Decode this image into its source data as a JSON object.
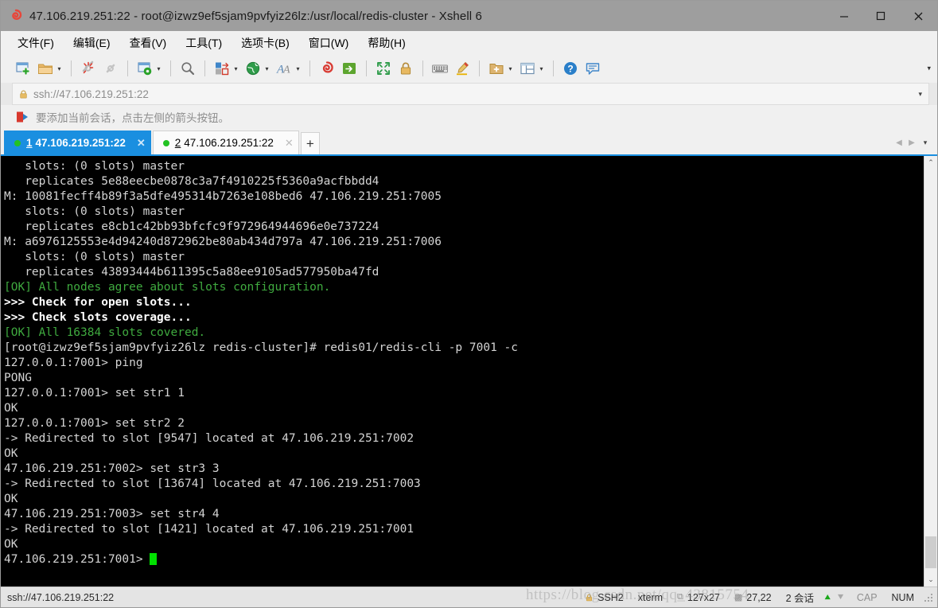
{
  "window": {
    "title": "47.106.219.251:22 - root@izwz9ef5sjam9pvfyiz26lz:/usr/local/redis-cluster - Xshell 6",
    "app_icon": "xshell-icon",
    "minimize": "–",
    "maximize": "☐",
    "close": "✕"
  },
  "menubar": {
    "items": [
      {
        "text": "文件(F)",
        "name": "menu-file"
      },
      {
        "text": "编辑(E)",
        "name": "menu-edit"
      },
      {
        "text": "查看(V)",
        "name": "menu-view"
      },
      {
        "text": "工具(T)",
        "name": "menu-tools"
      },
      {
        "text": "选项卡(B)",
        "name": "menu-tabs"
      },
      {
        "text": "窗口(W)",
        "name": "menu-window"
      },
      {
        "text": "帮助(H)",
        "name": "menu-help"
      }
    ]
  },
  "toolbar": {
    "overflow_caret": "▾",
    "items": [
      {
        "icon": "new-session-icon",
        "caret": false
      },
      {
        "icon": "open-folder-icon",
        "caret": true
      },
      {
        "sep": true
      },
      {
        "icon": "disconnect-icon",
        "caret": false
      },
      {
        "icon": "reconnect-icon",
        "caret": false
      },
      {
        "sep": true
      },
      {
        "icon": "session-properties-icon",
        "caret": true
      },
      {
        "sep": true
      },
      {
        "icon": "find-icon",
        "caret": false
      },
      {
        "sep": true
      },
      {
        "icon": "transfer-icon",
        "caret": true
      },
      {
        "icon": "globe-icon",
        "caret": true
      },
      {
        "icon": "font-icon",
        "caret": true
      },
      {
        "sep": true
      },
      {
        "icon": "xshell-log-icon",
        "caret": false
      },
      {
        "icon": "xftp-icon",
        "caret": false
      },
      {
        "sep": true
      },
      {
        "icon": "fullscreen-icon",
        "caret": false
      },
      {
        "icon": "lock-icon",
        "caret": false
      },
      {
        "sep": true
      },
      {
        "icon": "keyboard-icon",
        "caret": false
      },
      {
        "icon": "highlight-icon",
        "caret": false
      },
      {
        "sep": true
      },
      {
        "icon": "new-folder-icon",
        "caret": true
      },
      {
        "icon": "split-view-icon",
        "caret": true
      },
      {
        "sep": true
      },
      {
        "icon": "help-icon",
        "caret": false
      },
      {
        "icon": "chat-icon",
        "caret": false
      }
    ]
  },
  "address_bar": {
    "lock_icon": "lock-icon",
    "value": "ssh://47.106.219.251:22",
    "placeholder": "ssh://47.106.219.251:22",
    "caret": "▾"
  },
  "hint_bar": {
    "icon": "arrow-flag-icon",
    "text": "要添加当前会话，点击左侧的箭头按钮。"
  },
  "tabs": {
    "items": [
      {
        "number": "1",
        "label": "47.106.219.251:22",
        "active": true,
        "close": "✕",
        "dot_color": "#23c223"
      },
      {
        "number": "2",
        "label": "47.106.219.251:22",
        "active": false,
        "close": "✕",
        "dot_color": "#23c223"
      }
    ],
    "add_label": "+",
    "nav_prev": "◀",
    "nav_next": "▶",
    "nav_caret": "▾"
  },
  "terminal": {
    "lines": [
      {
        "text": "   slots: (0 slots) master",
        "style": "white"
      },
      {
        "text": "   replicates 5e88eecbe0878c3a7f4910225f5360a9acfbbdd4",
        "style": "white"
      },
      {
        "text": "M: 10081fecff4b89f3a5dfe495314b7263e108bed6 47.106.219.251:7005",
        "style": "white"
      },
      {
        "text": "   slots: (0 slots) master",
        "style": "white"
      },
      {
        "text": "   replicates e8cb1c42bb93bfcfc9f972964944696e0e737224",
        "style": "white"
      },
      {
        "text": "M: a6976125553e4d94240d872962be80ab434d797a 47.106.219.251:7006",
        "style": "white"
      },
      {
        "text": "   slots: (0 slots) master",
        "style": "white"
      },
      {
        "text": "   replicates 43893444b611395c5a88ee9105ad577950ba47fd",
        "style": "white"
      },
      {
        "text": "[OK] All nodes agree about slots configuration.",
        "style": "green"
      },
      {
        "text": ">>> Check for open slots...",
        "style": "bold"
      },
      {
        "text": ">>> Check slots coverage...",
        "style": "bold"
      },
      {
        "text": "[OK] All 16384 slots covered.",
        "style": "green"
      },
      {
        "text": "[root@izwz9ef5sjam9pvfyiz26lz redis-cluster]# redis01/redis-cli -p 7001 -c",
        "style": "white"
      },
      {
        "text": "127.0.0.1:7001> ping",
        "style": "white"
      },
      {
        "text": "PONG",
        "style": "white"
      },
      {
        "text": "127.0.0.1:7001> set str1 1",
        "style": "white"
      },
      {
        "text": "OK",
        "style": "white"
      },
      {
        "text": "127.0.0.1:7001> set str2 2",
        "style": "white"
      },
      {
        "text": "-> Redirected to slot [9547] located at 47.106.219.251:7002",
        "style": "white"
      },
      {
        "text": "OK",
        "style": "white"
      },
      {
        "text": "47.106.219.251:7002> set str3 3",
        "style": "white"
      },
      {
        "text": "-> Redirected to slot [13674] located at 47.106.219.251:7003",
        "style": "white"
      },
      {
        "text": "OK",
        "style": "white"
      },
      {
        "text": "47.106.219.251:7003> set str4 4",
        "style": "white"
      },
      {
        "text": "-> Redirected to slot [1421] located at 47.106.219.251:7001",
        "style": "white"
      },
      {
        "text": "OK",
        "style": "white"
      },
      {
        "text": "47.106.219.251:7001> ",
        "style": "white",
        "cursor": true
      }
    ],
    "scroll": {
      "up_arrow": "⌃",
      "down_arrow": "⌄"
    }
  },
  "statusbar": {
    "connection": "ssh://47.106.219.251:22",
    "protocol_icon": "lock-icon",
    "protocol": "SSH2",
    "terminal_type": "xterm",
    "size_icon": "size-icon",
    "size": "127x27",
    "cursor_icon": "cursor-icon",
    "cursor_pos": "27,22",
    "sessions": "2 会话",
    "arrow_up": "↑",
    "arrow_down": "↓",
    "caps": "CAP",
    "num": "NUM",
    "watermark": "https://blog.csdn.net/qq_43815754"
  },
  "colors": {
    "accent": "#1a8fe0",
    "titlebar": "#9e9e9e",
    "chrome": "#f0f0f0",
    "terminal_bg": "#000000",
    "terminal_fg": "#d4d4d4",
    "terminal_green": "#3faa3f",
    "cursor": "#00e000"
  }
}
